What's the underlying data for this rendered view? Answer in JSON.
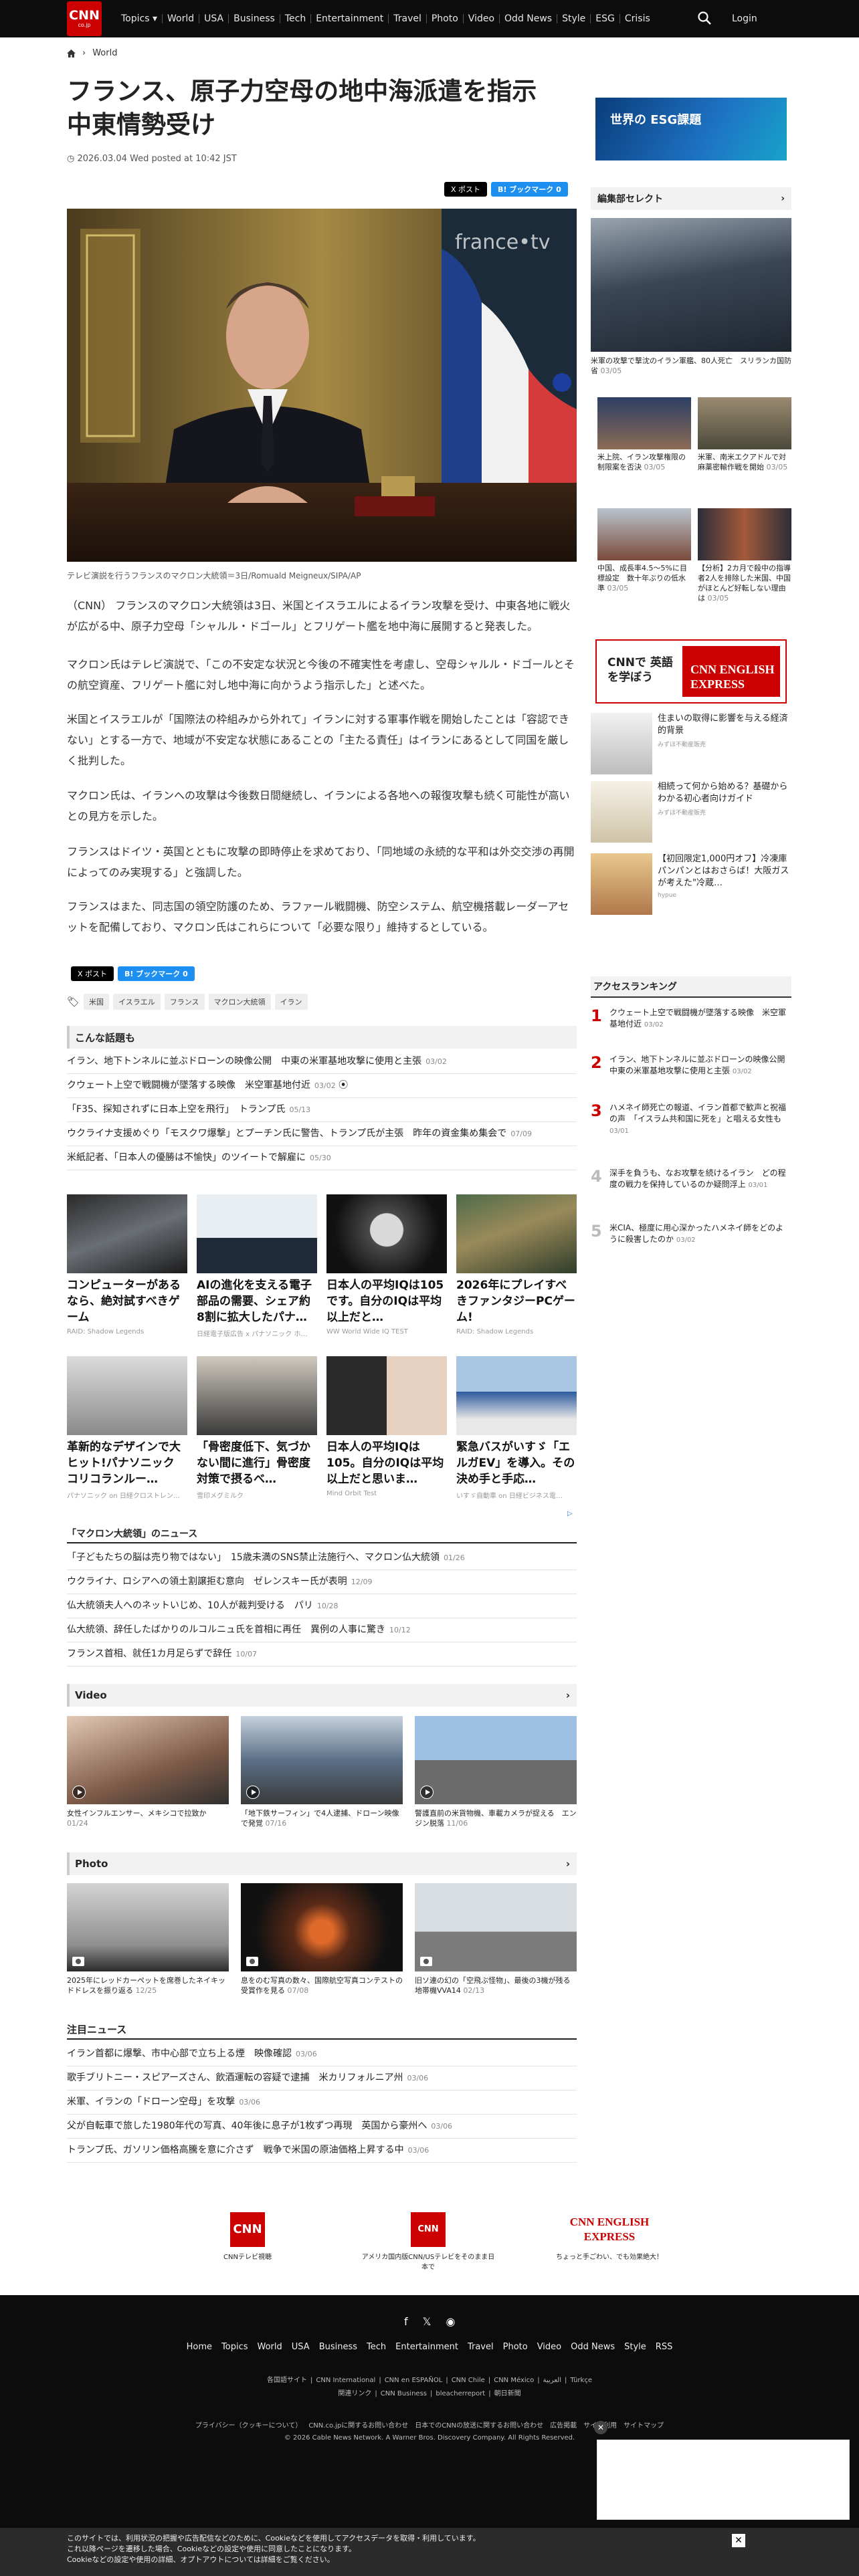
{
  "header": {
    "logo": "CNN",
    "logo_sub": "co.jp",
    "nav": [
      "Topics ▾",
      "World",
      "USA",
      "Business",
      "Tech",
      "Entertainment",
      "Travel",
      "Photo",
      "Video",
      "Odd News",
      "Style",
      "ESG",
      "Crisis"
    ],
    "login": "Login"
  },
  "breadcrumb": {
    "home_icon": "home-icon",
    "section": "World"
  },
  "article": {
    "title": "フランス、原子力空母の地中海派遣を指示　中東情勢受け",
    "date": "2026.03.04 Wed posted at 10:42 JST",
    "share_x": "X ポスト",
    "share_b": "B! ブックマーク 0",
    "caption": "テレビ演説を行うフランスのマクロン大統領＝3日/Romuald Meigneux/SIPA/AP",
    "paragraphs": [
      "（CNN） フランスのマクロン大統領は3日、米国とイスラエルによるイラン攻撃を受け、中東各地に戦火が広がる中、原子力空母「シャルル・ドゴール」とフリゲート艦を地中海に展開すると発表した。",
      "マクロン氏はテレビ演説で、「この不安定な状況と今後の不確実性を考慮し、空母シャルル・ドゴールとその航空資産、フリゲート艦に対し地中海に向かうよう指示した」と述べた。",
      "米国とイスラエルが「国際法の枠組みから外れて」イランに対する軍事作戦を開始したことは「容認できない」とする一方で、地域が不安定な状態にあることの「主たる責任」はイランにあるとして同国を厳しく批判した。",
      "マクロン氏は、イランへの攻撃は今後数日間継続し、イランによる各地への報復攻撃も続く可能性が高いとの見方を示した。",
      "フランスはドイツ・英国とともに攻撃の即時停止を求めており、「同地域の永続的な平和は外交交渉の再開によってのみ実現する」と強調した。",
      "フランスはまた、同志国の領空防護のため、ラファール戦闘機、防空システム、航空機搭載レーダーアセットを配備しており、マクロン氏はこれらについて「必要な限り」維持するとしている。"
    ],
    "tags": [
      "米国",
      "イスラエル",
      "フランス",
      "マクロン大統領",
      "イラン"
    ]
  },
  "related": {
    "title": "こんな話題も",
    "items": [
      {
        "text": "イラン、地下トンネルに並ぶドローンの映像公開　中東の米軍基地攻撃に使用と主張",
        "date": "03/02"
      },
      {
        "text": "クウェート上空で戦闘機が墜落する映像　米空軍基地付近",
        "date": "03/02"
      },
      {
        "text": "「F35、探知されずに日本上空を飛行」　トランプ氏",
        "date": "05/13"
      },
      {
        "text": "ウクライナ支援めぐり「モスクワ爆撃」とプーチン氏に警告、トランプ氏が主張　昨年の資金集め集会で",
        "date": "07/09"
      },
      {
        "text": "米紙記者、「日本人の優勝は不愉快」のツイートで解雇に",
        "date": "05/30"
      }
    ]
  },
  "ads": [
    {
      "title": "コンピューターがあるなら、絶対試すべきゲーム",
      "source": "RAID: Shadow Legends"
    },
    {
      "title": "AIの進化を支える電子部品の需要、シェア約8割に拡大したパナ…",
      "source": "日経電子版広告 x パナソニック ホ…"
    },
    {
      "title": "日本人の平均IQは105です。自分のIQは平均以上だと…",
      "source": "WW World Wide IQ TEST"
    },
    {
      "title": "2026年にプレイすべきファンタジーPCゲーム!",
      "source": "RAID: Shadow Legends"
    },
    {
      "title": "革新的なデザインで大ヒット!パナソニック コリコランルー…",
      "source": "パナソニック on 日経クロストレン…"
    },
    {
      "title": "「骨密度低下、気づかない間に進行」骨密度対策で摂るべ…",
      "source": "雪印メグミルク"
    },
    {
      "title": "日本人の平均IQは105。自分のIQは平均以上だと思いま…",
      "source": "Mind Orbit Test"
    },
    {
      "title": "緊急バスがいすゞ「エルガEV」を導入。その決め手と手応…",
      "source": "いすゞ自動車 on 日経ビジネス電…"
    }
  ],
  "macron_news": {
    "title": "「マクロン大統領」のニュース",
    "items": [
      {
        "text": "「子どもたちの脳は売り物ではない」　15歳未満のSNS禁止法施行へ、マクロン仏大統領",
        "date": "01/26"
      },
      {
        "text": "ウクライナ、ロシアへの領土割譲拒む意向　ゼレンスキー氏が表明",
        "date": "12/09"
      },
      {
        "text": "仏大統領夫人へのネットいじめ、10人が裁判受ける　パリ",
        "date": "10/28"
      },
      {
        "text": "仏大統領、辞任したばかりのルコルニュ氏を首相に再任　異例の人事に驚き",
        "date": "10/12"
      },
      {
        "text": "フランス首相、就任1カ月足らずで辞任",
        "date": "10/07"
      }
    ]
  },
  "video": {
    "title": "Video",
    "items": [
      {
        "text": "女性インフルエンサー、メキシコで拉致か",
        "date": "01/24"
      },
      {
        "text": "「地下鉄サーフィン」で4人逮捕、ドローン映像で発覚",
        "date": "07/16"
      },
      {
        "text": "警護直前の米貨物機、車載カメラが捉える　エンジン脱落",
        "date": "11/06"
      }
    ]
  },
  "photo": {
    "title": "Photo",
    "items": [
      {
        "text": "2025年にレッドカーペットを席巻したネイキッドドレスを振り返る",
        "date": "12/25"
      },
      {
        "text": "息をのむ写真の数々、国際航空写真コンテストの受賞作を見る",
        "date": "07/08"
      },
      {
        "text": "旧ソ連の幻の「空飛ぶ怪物」、最後の3機が残る地帯機VVA14",
        "date": "02/13"
      }
    ]
  },
  "notable": {
    "title": "注目ニュース",
    "items": [
      {
        "text": "イラン首都に爆撃、市中心部で立ち上る煙　映像確認",
        "date": "03/06"
      },
      {
        "text": "歌手ブリトニー・スピアーズさん、飲酒運転の容疑で逮捕　米カリフォルニア州",
        "date": "03/06"
      },
      {
        "text": "米軍、イランの「ドローン空母」を攻撃",
        "date": "03/06"
      },
      {
        "text": "父が自転車で旅した1980年代の写真、40年後に息子が1枚ずつ再現　英国から豪州へ",
        "date": "03/06"
      },
      {
        "text": "トランプ氏、ガソリン価格高騰を意に介さず　戦争で米国の原油価格上昇する中",
        "date": "03/06"
      }
    ]
  },
  "promos": [
    {
      "logo": "CNN",
      "label": "CNNテレビ視聴"
    },
    {
      "logo": "CNN US",
      "label": "アメリカ国内版CNN/USテレビをそのまま日本で"
    },
    {
      "logo": "CNN ENGLISH EXPRESS",
      "label": "ちょっと手ごわい、でも効果絶大！"
    }
  ],
  "sidebar": {
    "esg_banner": "世界の ESG課題",
    "editor_title": "編集部セレクト",
    "featured": {
      "text": "米軍の攻撃で撃沈のイラン軍艦、80人死亡　スリランカ国防省",
      "date": "03/05"
    },
    "thumbs": [
      {
        "text": "米上院、イラン攻撃権限の制限案を否決",
        "date": "03/05"
      },
      {
        "text": "米軍、南米エクアドルで対麻薬密輸作戦を開始",
        "date": "03/05"
      },
      {
        "text": "中国、成長率4.5～5%に目標設定　数十年ぶりの低水準",
        "date": "03/05"
      },
      {
        "text": "【分析】2カ月で殺中の指導者2人を排除した米国、中国がほとんど好転しない理由は",
        "date": "03/05"
      }
    ],
    "english_banner_left": "CNNで 英語を学ぼう",
    "english_banner_right": "CNN ENGLISH EXPRESS",
    "sponsored": [
      {
        "text": "住まいの取得に影響を与える経済的背景",
        "source": "みずほ不動産販売"
      },
      {
        "text": "相続って何から始める？基礎からわかる初心者向けガイド",
        "source": "みずほ不動産販売"
      },
      {
        "text": "【初回限定1,000円オフ】冷凍庫パンパンとはおさらば！大阪ガスが考えた\"冷蔵…",
        "source": "hypue"
      }
    ],
    "ranking_title": "アクセスランキング",
    "ranking": [
      {
        "n": "1",
        "text": "クウェート上空で戦闘機が墜落する映像　米空軍基地付近",
        "date": "03/02"
      },
      {
        "n": "2",
        "text": "イラン、地下トンネルに並ぶドローンの映像公開　中東の米軍基地攻撃に使用と主張",
        "date": "03/02"
      },
      {
        "n": "3",
        "text": "ハメネイ師死亡の報道、イラン首都で歓声と祝福の声　「イスラム共和国に死を」と唱える女性も",
        "date": "03/01"
      },
      {
        "n": "4",
        "text": "深手を負うも、なお攻撃を続けるイラン　どの程度の戦力を保持しているのか疑問浮上",
        "date": "03/01"
      },
      {
        "n": "5",
        "text": "米CIA、極度に用心深かったハメネイ師をどのように殺害したのか",
        "date": "03/02"
      }
    ]
  },
  "footer": {
    "nav": [
      "Home",
      "Topics",
      "World",
      "USA",
      "Business",
      "Tech",
      "Entertainment",
      "Travel",
      "Photo",
      "Video",
      "Odd News",
      "Style",
      "RSS"
    ],
    "sites1": [
      "各国語サイト",
      "CNN International",
      "CNN en ESPAÑOL",
      "CNN Chile",
      "CNN México",
      "العربية",
      "Türkçe"
    ],
    "sites2": [
      "関連リンク",
      "CNN Business",
      "bleacherreport",
      "朝日新聞"
    ],
    "legal": [
      "プライバシー（クッキーについて）",
      "CNN.co.jpに関するお問い合わせ",
      "日本でのCNNの放送に関するお問い合わせ",
      "広告掲載",
      "サイト利用",
      "サイトマップ"
    ],
    "copyright": "© 2026 Cable News Network. A Warner Bros. Discovery Company. All Rights Reserved.",
    "cookie": [
      "このサイトでは、利用状況の把握や広告配信などのために、Cookieなどを使用してアクセスデータを取得・利用しています。",
      "これ以降ページを遷移した場合、Cookieなどの設定や使用に同意したことになります。",
      "Cookieなどの設定や使用の詳細、オプトアウトについては詳細をご覧ください。"
    ]
  }
}
